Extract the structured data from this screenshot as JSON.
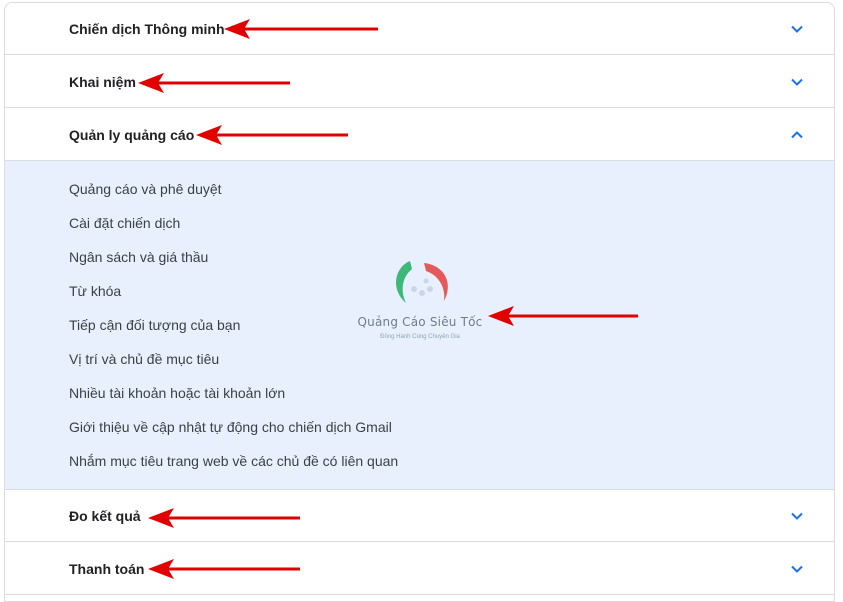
{
  "accordion": {
    "sections": [
      {
        "title": "Chiến dịch Thông minh",
        "expanded": false
      },
      {
        "title": "Khai niệm",
        "expanded": false
      },
      {
        "title": "Quản ly quảng cáo",
        "expanded": true
      },
      {
        "title": "Đo kết quả",
        "expanded": false
      },
      {
        "title": "Thanh toán",
        "expanded": false
      }
    ],
    "expanded_items": [
      "Quảng cáo và phê duyệt",
      "Cài đặt chiến dịch",
      "Ngân sách và giá thầu",
      "Từ khóa",
      "Tiếp cận đối tượng của bạn",
      "Vị trí và chủ đề mục tiêu",
      "Nhiều tài khoản hoặc tài khoản lớn",
      "Giới thiệu về cập nhật tự động cho chiến dịch Gmail",
      "Nhắm mục tiêu trang web về các chủ đề có liên quan"
    ]
  },
  "watermark": {
    "brand": "Quảng Cáo Siêu Tốc",
    "tagline": "Đồng Hành Cùng Chuyên Gia"
  },
  "colors": {
    "accent": "#1a73e8",
    "panel_bg": "#e8f0fe",
    "annotation_arrow": "#e00000"
  },
  "icons": {
    "collapsed": "chevron-down-icon",
    "expanded": "chevron-up-icon",
    "annotation": "red-arrow-icon"
  }
}
